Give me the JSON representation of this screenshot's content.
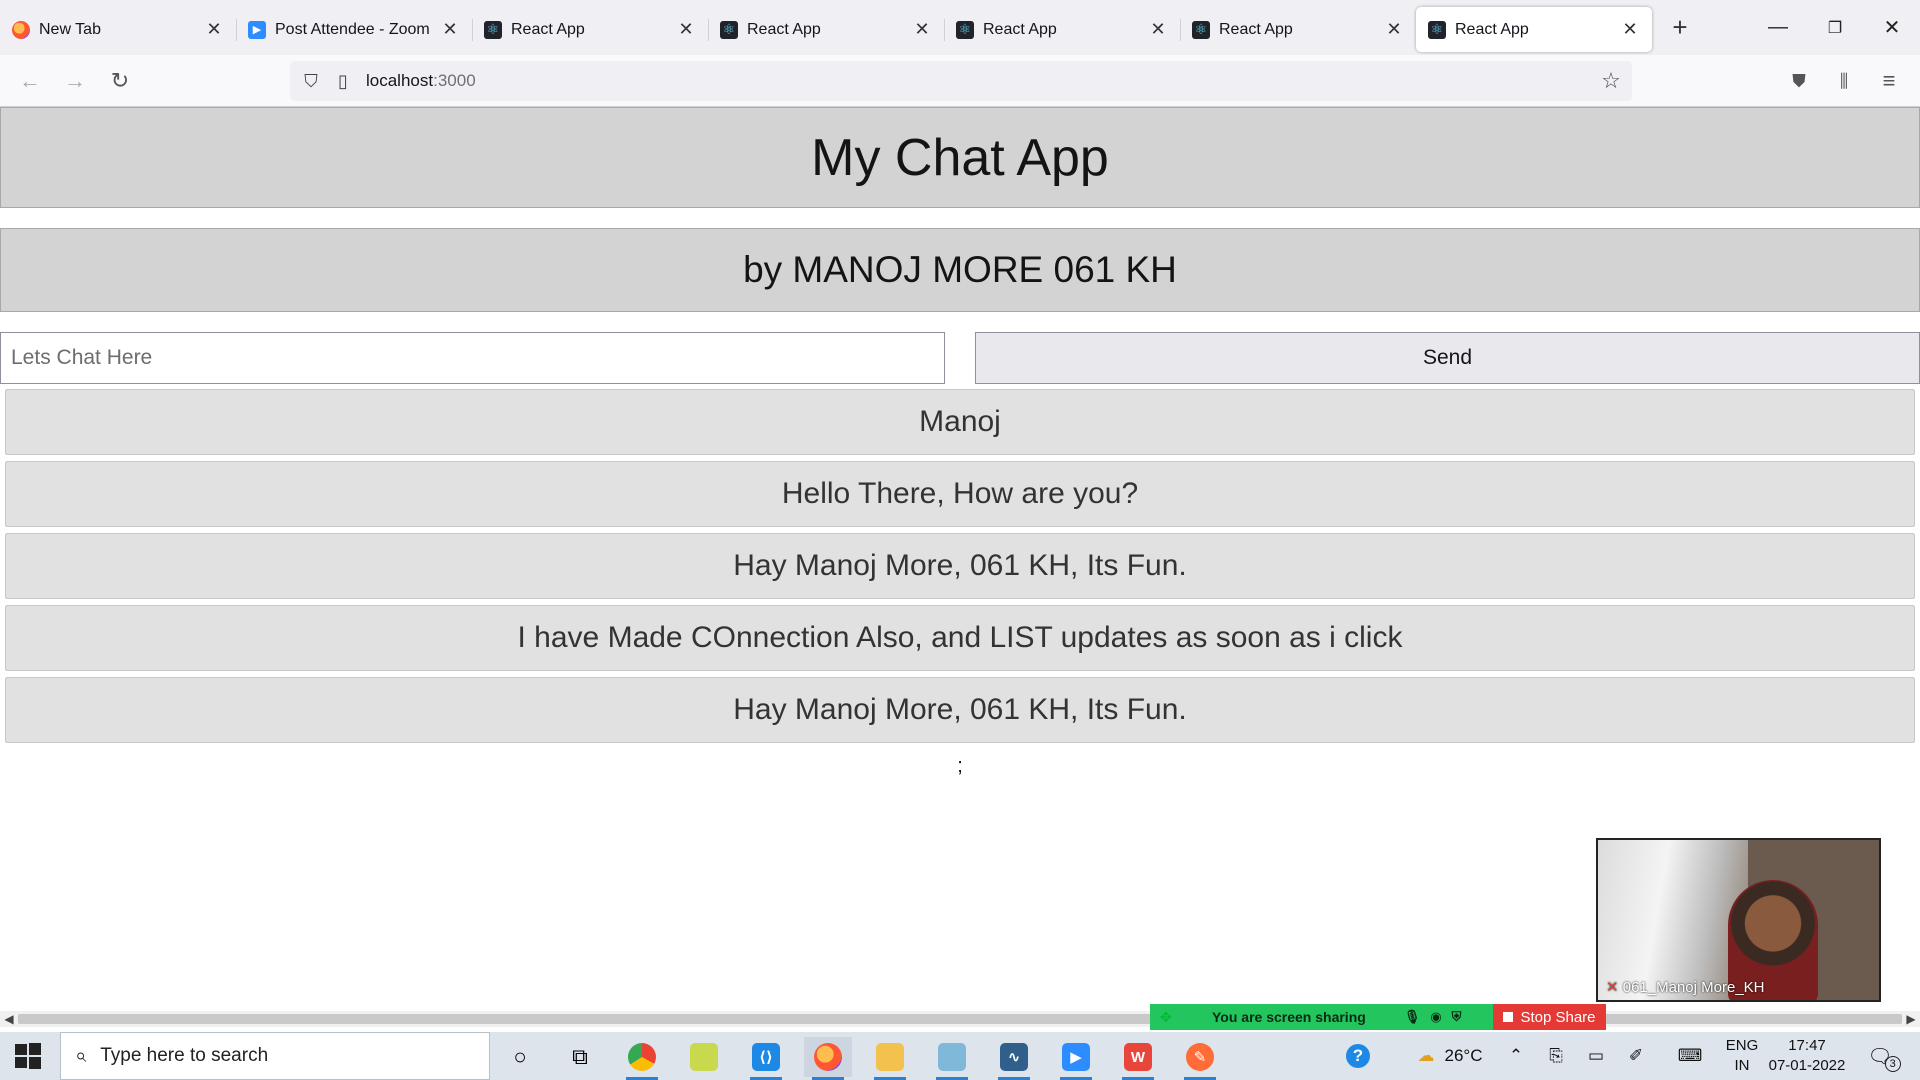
{
  "tabs": [
    {
      "label": "New Tab",
      "icon": "firefox-icon",
      "active": false
    },
    {
      "label": "Post Attendee - Zoom",
      "icon": "zoom-icon",
      "active": false
    },
    {
      "label": "React App",
      "icon": "react-icon",
      "active": false
    },
    {
      "label": "React App",
      "icon": "react-icon",
      "active": false
    },
    {
      "label": "React App",
      "icon": "react-icon",
      "active": false
    },
    {
      "label": "React App",
      "icon": "react-icon",
      "active": false
    },
    {
      "label": "React App",
      "icon": "react-icon",
      "active": true
    }
  ],
  "urlbar": {
    "host": "localhost",
    "port": ":3000"
  },
  "page": {
    "title": "My Chat App",
    "byline": "by MANOJ MORE 061 KH",
    "input_placeholder": "Lets Chat Here",
    "send_label": "Send",
    "messages": [
      "Manoj",
      "Hello There, How are you?",
      "Hay Manoj More, 061 KH, Its Fun.",
      "I have Made COnnection Also, and LIST updates as soon as i click",
      "Hay Manoj More, 061 KH, Its Fun."
    ],
    "trailer": ";"
  },
  "zoom": {
    "share_status": "You are screen sharing",
    "stop_share": "Stop Share",
    "participant_name": "061_Manoj More_KH"
  },
  "taskbar": {
    "search_placeholder": "Type here to search",
    "weather": "26°C",
    "lang_top": "ENG",
    "lang_bottom": "IN",
    "time": "17:47",
    "date": "07-01-2022",
    "notification_count": "3"
  },
  "colors": {
    "banner_bg": "#d3d3d3",
    "message_bg": "#e1e1e1",
    "share_green": "#22c55e",
    "stop_red": "#e53935"
  }
}
